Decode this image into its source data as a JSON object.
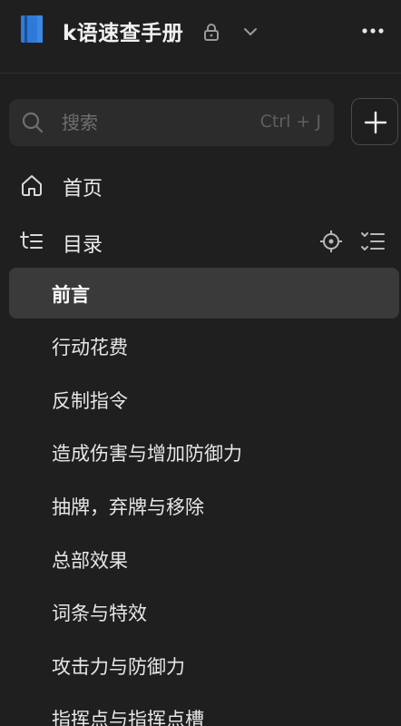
{
  "header": {
    "title": "k语速查手册",
    "icons": [
      "book-icon",
      "lock-icon",
      "chevron-down-icon",
      "more-icon"
    ],
    "accent": "#2f7ad8"
  },
  "search": {
    "placeholder": "搜索",
    "shortcut": "Ctrl + J"
  },
  "nav": {
    "home": "首页",
    "toc": "目录"
  },
  "toc": {
    "items": [
      {
        "label": "前言",
        "active": true
      },
      {
        "label": "行动花费"
      },
      {
        "label": "反制指令"
      },
      {
        "label": "造成伤害与增加防御力"
      },
      {
        "label": "抽牌，弃牌与移除"
      },
      {
        "label": "总部效果"
      },
      {
        "label": "词条与特效"
      },
      {
        "label": "攻击力与防御力"
      },
      {
        "label": "指挥点与指挥点槽"
      }
    ]
  }
}
